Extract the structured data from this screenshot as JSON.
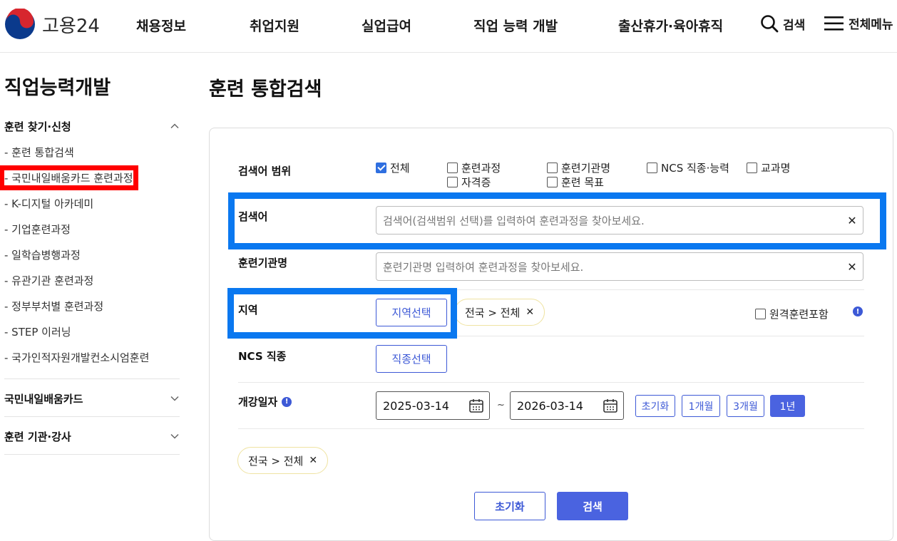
{
  "header": {
    "logo_text": "고용24",
    "nav": [
      "채용정보",
      "취업지원",
      "실업급여",
      "직업 능력 개발",
      "출산휴가·육아휴직"
    ],
    "search_label": "검색",
    "menu_label": "전체메뉴"
  },
  "sidebar": {
    "title": "직업능력개발",
    "group1": "훈련 찾기·신청",
    "items": [
      "- 훈련 통합검색",
      "- 국민내일배움카드 훈련과정",
      "- K-디지털 아카데미",
      "- 기업훈련과정",
      "- 일학습병행과정",
      "- 유관기관 훈련과정",
      "- 정부부처별 훈련과정",
      "- STEP 이러닝",
      "- 국가인적자원개발컨소시엄훈련"
    ],
    "group2": "국민내일배움카드",
    "group3": "훈련 기관·강사"
  },
  "main": {
    "title": "훈련 통합검색",
    "scope": {
      "label": "검색어 범위",
      "options": [
        "전체",
        "훈련과정",
        "훈련기관명",
        "NCS 직종·능력",
        "교과명",
        "자격증",
        "훈련 목표"
      ],
      "checked": "전체"
    },
    "keyword": {
      "label": "검색어",
      "placeholder": "검색어(검색범위 선택)를 입력하여 훈련과정을 찾아보세요."
    },
    "institution": {
      "label": "훈련기관명",
      "placeholder": "훈련기관명 입력하여 훈련과정을 찾아보세요."
    },
    "region": {
      "label": "지역",
      "button": "지역선택",
      "chip": "전국 > 전체",
      "remote_label": "원격훈련포함"
    },
    "ncs": {
      "label": "NCS 직종",
      "button": "직종선택"
    },
    "date": {
      "label": "개강일자",
      "start": "2025-03-14",
      "end": "2026-03-14",
      "separator": "~",
      "periods": [
        "초기화",
        "1개월",
        "3개월",
        "1년"
      ],
      "active_period": "1년"
    },
    "selected_chip": "전국 > 전체",
    "reset_button": "초기화",
    "search_button": "검색"
  },
  "colors": {
    "accent": "#4a63e0",
    "highlight_blue": "#0a78f0",
    "highlight_red": "#ff0000"
  }
}
